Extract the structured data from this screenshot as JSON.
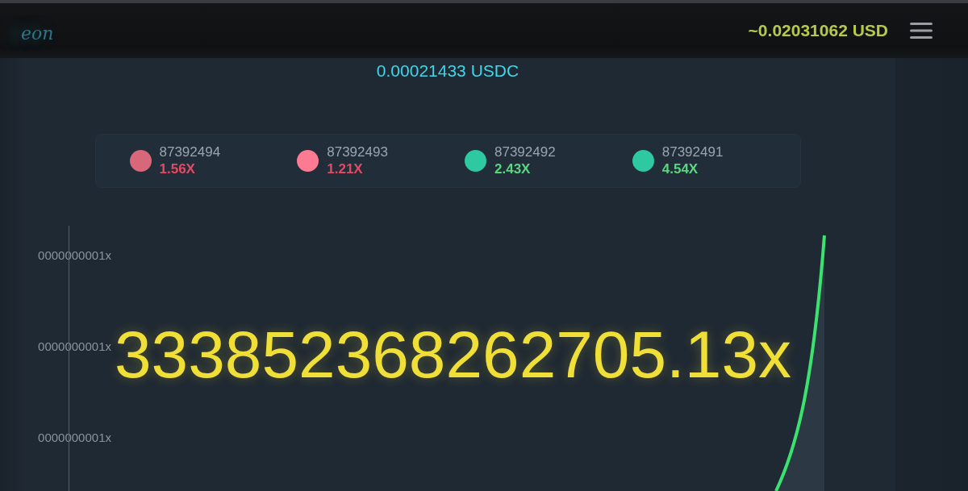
{
  "header": {
    "logo_text": "eon",
    "balance_usd": "~0.02031062 USD"
  },
  "balance": "0.00021433 USDC",
  "history": [
    {
      "round": "87392494",
      "multiplier": "1.56X",
      "kind": "loss",
      "color": "#d9677a"
    },
    {
      "round": "87392493",
      "multiplier": "1.21X",
      "kind": "loss",
      "color": "#fb7c92"
    },
    {
      "round": "87392492",
      "multiplier": "2.43X",
      "kind": "win",
      "color": "#2ec9a0"
    },
    {
      "round": "87392491",
      "multiplier": "4.54X",
      "kind": "win",
      "color": "#2ec9a0"
    }
  ],
  "chart": {
    "y_labels": [
      "0000000001x",
      "0000000001x",
      "0000000001x"
    ],
    "multiplier": "333852368262705.13x"
  }
}
